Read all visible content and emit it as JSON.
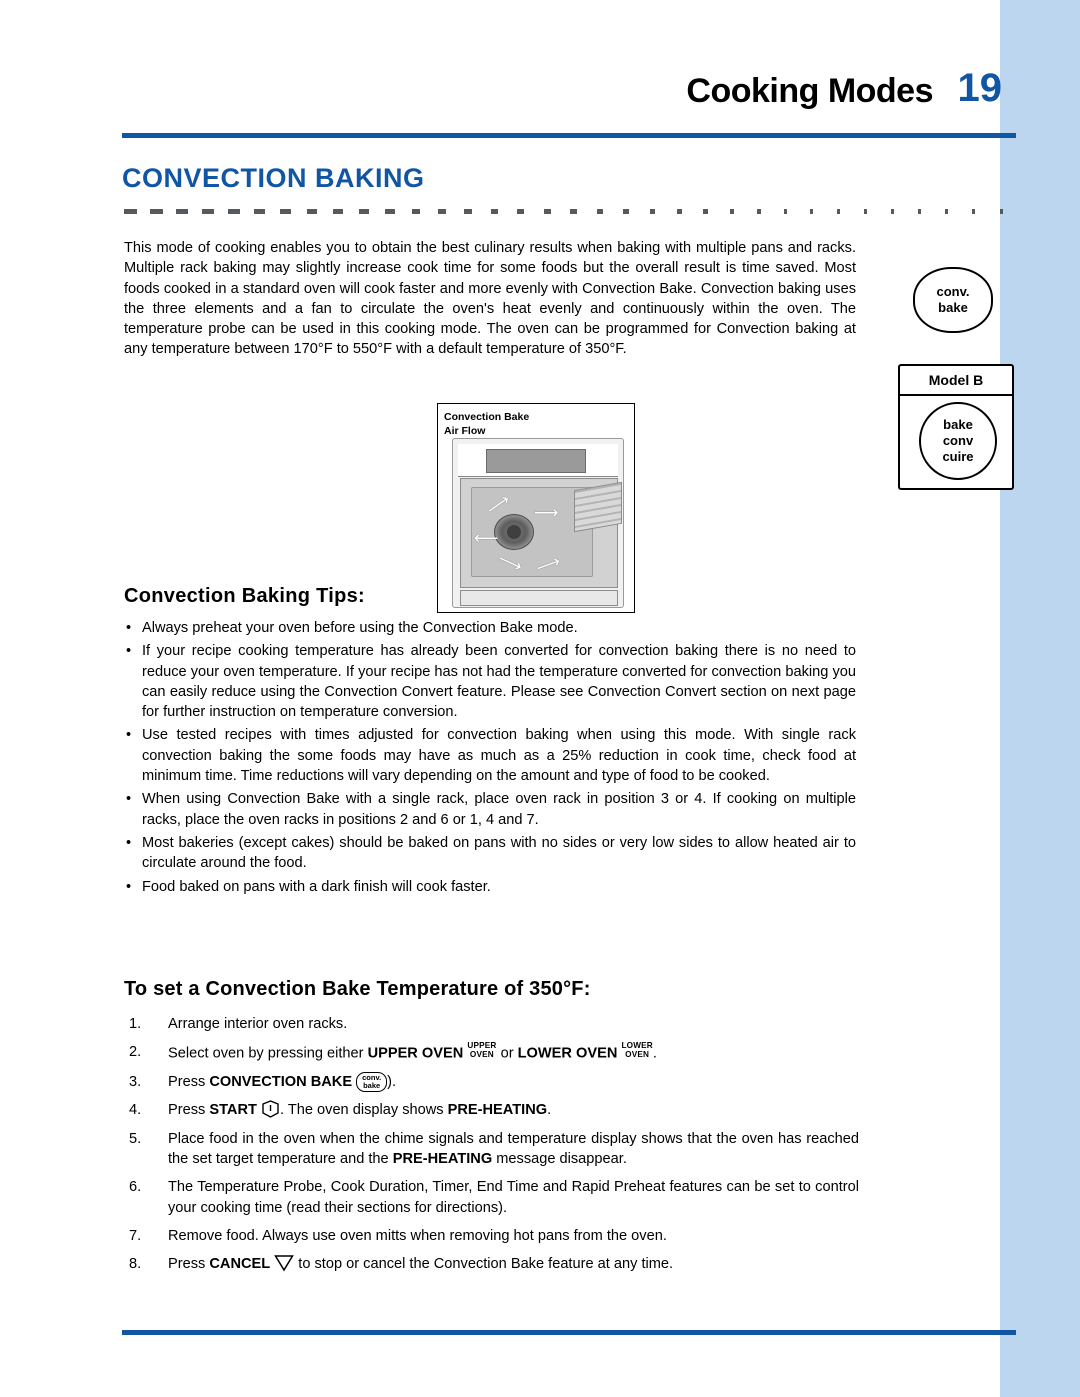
{
  "header": {
    "title": "Cooking Modes",
    "page_number": "19"
  },
  "section": {
    "title": "CONVECTION BAKING",
    "intro": "This mode of cooking enables you to obtain the best culinary results when baking with multiple pans and racks. Multiple rack baking may slightly increase cook time for some foods but the overall result is time saved. Most foods cooked in a standard oven will cook faster and more evenly with Convection Bake. Convection baking uses the three elements and a fan to circulate the oven's heat evenly and continuously within the oven. The temperature probe can be used in this cooking mode. The oven can be programmed for Convection baking at any temperature between 170°F to 550°F with a default temperature of 350°F."
  },
  "figure": {
    "caption_line1": "Convection  Bake",
    "caption_line2": "Air  Flow"
  },
  "tips": {
    "heading": "Convection  Baking  Tips:",
    "bullet_char": "•",
    "items": [
      "Always preheat your oven before using the Convection Bake mode.",
      "If your recipe cooking temperature has already been converted for convection baking there is no need to reduce your oven temperature. If your recipe has not had the temperature converted for convection baking you can easily reduce using the Convection Convert feature. Please see Convection Convert section on next page for further instruction on temperature conversion.",
      "Use tested recipes with times adjusted for convection baking when using this mode. With single rack convection baking the some foods may have as much as a 25% reduction in cook time, check food at minimum time. Time reductions will vary depending on the amount and type of food to be cooked.",
      "When using Convection Bake with a single rack, place oven rack in position 3 or 4. If cooking on multiple racks, place the oven racks in positions 2 and 6 or 1, 4 and 7.",
      "Most bakeries (except cakes) should be baked on pans with no sides or very low sides to allow heated air to circulate around the food.",
      "Food baked on pans with a dark finish will cook faster."
    ]
  },
  "procedure": {
    "heading": "To  set  a  Convection  Bake  Temperature  of  350°F:",
    "steps": [
      {
        "num": "1.",
        "text": "Arrange interior oven racks."
      },
      {
        "num": "2.",
        "prefix": "Select oven by pressing either ",
        "bold1": "UPPER OVEN",
        "key1_top": "UPPER",
        "key1_bottom": "OVEN",
        "mid": " or ",
        "bold2": "LOWER OVEN",
        "key2_top": "LOWER",
        "key2_bottom": "OVEN",
        "suffix": "."
      },
      {
        "num": "3.",
        "prefix": "Press ",
        "bold1": "CONVECTION BAKE",
        "key_top": "conv.",
        "key_bottom": "bake",
        "suffix": ")."
      },
      {
        "num": "4.",
        "prefix": "Press ",
        "bold1": "START",
        "mid": ". The oven display shows ",
        "bold2": "PRE-HEATING",
        "suffix": "."
      },
      {
        "num": "5.",
        "prefix": "Place food in the oven when the chime signals and temperature display shows that the oven has reached the set target temperature and the ",
        "bold1": "PRE-HEATING",
        "suffix": " message disappear."
      },
      {
        "num": "6.",
        "text": "The Temperature Probe, Cook Duration, Timer, End Time and Rapid Preheat features can be set to control your cooking time (read their sections for directions)."
      },
      {
        "num": "7.",
        "text": "Remove food. Always use oven mitts when removing hot pans from the oven."
      },
      {
        "num": "8.",
        "prefix": "Press ",
        "bold1": "CANCEL",
        "suffix": " to stop or cancel the Convection Bake feature at any time."
      }
    ]
  },
  "keys": {
    "conv_bake": {
      "line1": "conv.",
      "line2": "bake"
    },
    "model_b_label": "Model B",
    "bake_conv_cuire": {
      "line1": "bake",
      "line2": "conv",
      "line3": "cuire"
    }
  },
  "colors": {
    "accent_blue": "#1156a5",
    "band_blue": "#bcd6ef",
    "text": "#000000"
  }
}
